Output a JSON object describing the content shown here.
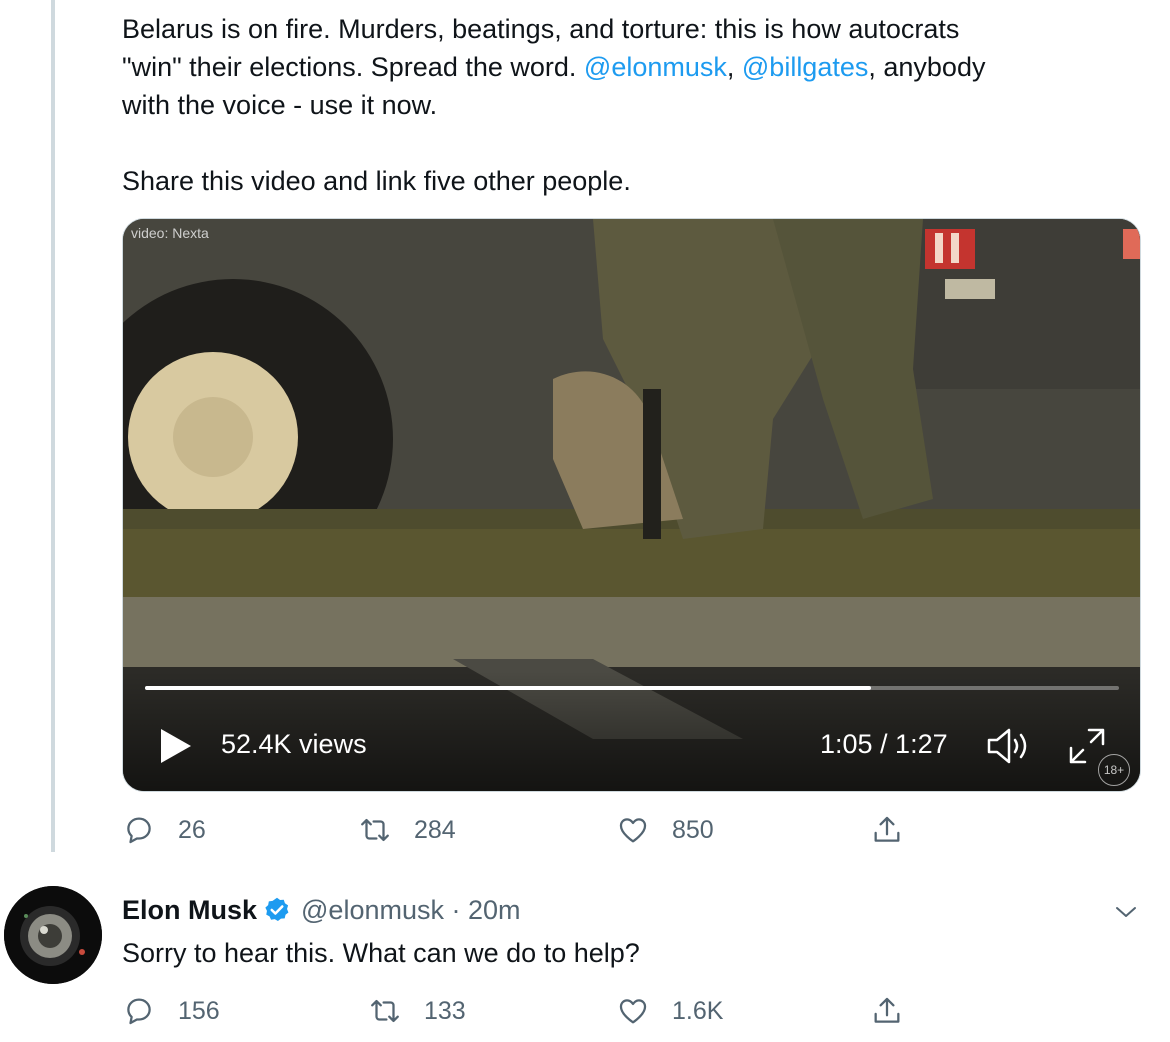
{
  "tweet": {
    "line1": "Belarus is on fire. Murders, beatings, and torture: this is how autocrats",
    "line2_pre": "\"win\" their elections. Spread the word. ",
    "mention1": "@elonmusk",
    "line2_mid": ", ",
    "mention2": "@billgates",
    "line2_post": ", anybody",
    "line3": "with the voice - use it now.",
    "line4": "Share this video and link five other people."
  },
  "video": {
    "credit": "video: Nexta",
    "views": "52.4K views",
    "time": "1:05 / 1:27",
    "progress": 0.745,
    "rating": "18+"
  },
  "tweet_actions": {
    "replies": "26",
    "retweets": "284",
    "likes": "850"
  },
  "reply": {
    "name": "Elon Musk",
    "handle_time": "@elonmusk · 20m",
    "text": "Sorry to hear this. What can we do to help?",
    "actions": {
      "replies": "156",
      "retweets": "133",
      "likes": "1.6K"
    }
  },
  "colors": {
    "link": "#1d9bf0",
    "muted": "#536471",
    "verified": "#1d9bf0"
  },
  "icons": [
    "reply-icon",
    "retweet-icon",
    "like-icon",
    "share-icon",
    "play-icon",
    "volume-icon",
    "fullscreen-icon",
    "verified-icon",
    "chevron-down-icon"
  ]
}
